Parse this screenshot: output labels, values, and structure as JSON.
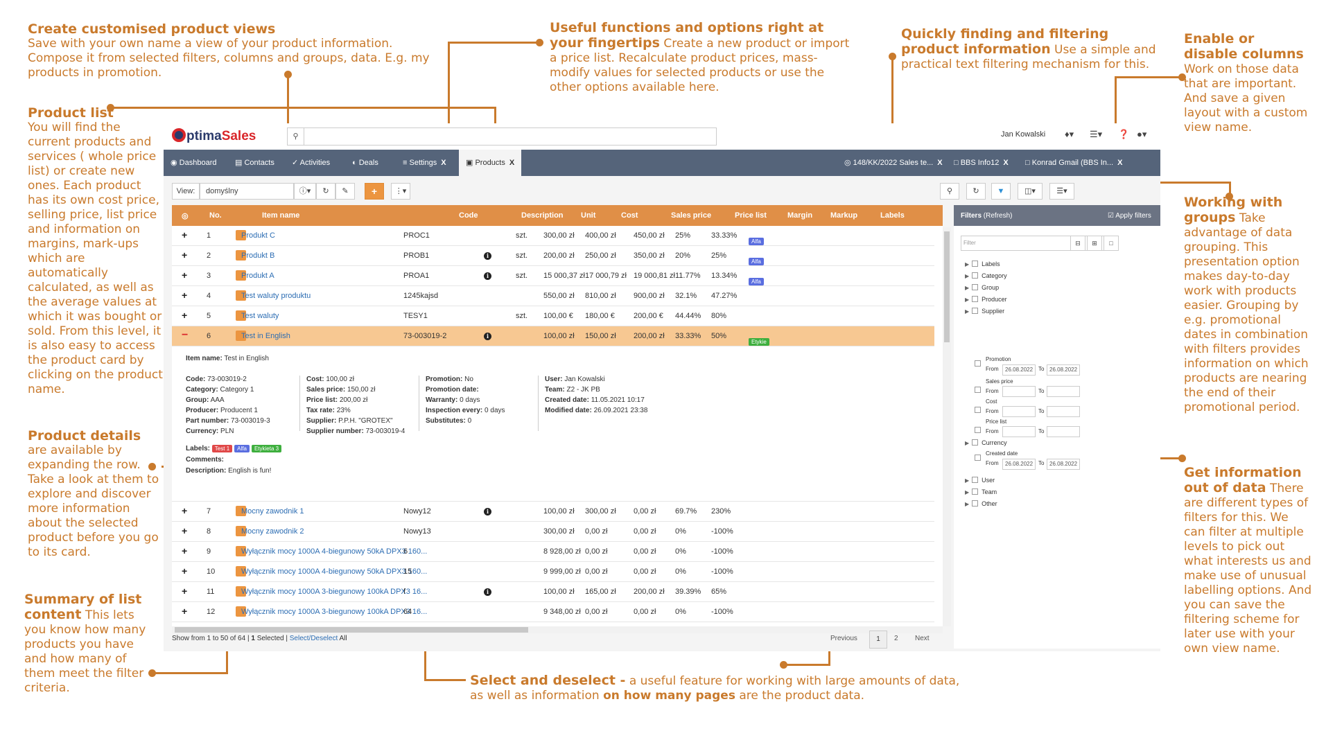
{
  "annotations": {
    "views": {
      "title": "Create customised product views",
      "body": "Save with your own name a view of your product information. Compose it from selected filters, columns and groups, data. E.g. my products in promotion."
    },
    "list": {
      "title": "Product list",
      "body": "You will find the current products and services ( whole price list) or create new ones. Each product has its own cost price, selling price, list price and information on margins, mark-ups which are automatically calculated, as well as the average values at which it was bought or sold. From this level, it is also easy to access the product card by clicking on the product name."
    },
    "details": {
      "title": "Product details",
      "body": "are available by expanding the row. Take a look at them to explore and discover more information about the selected product before you go to its card."
    },
    "summary": {
      "title": "Summary of list content",
      "body": "This lets you know how many products you have and how many of them meet the filter criteria."
    },
    "functions": {
      "title": "Useful functions and options right at your fingertips",
      "body": "Create a new product or import a price list. Recalculate product prices, mass-modify values for selected products or use the other options available here."
    },
    "finding": {
      "title": "Quickly finding and filtering product information",
      "body": "Use a simple and practical text filtering mechanism for this."
    },
    "columns": {
      "title": "Enable or disable columns",
      "body": "Work on those data that are important. And save a given layout with a custom view name."
    },
    "groups": {
      "title": "Working with groups",
      "body": "Take advantage of data grouping. This presentation option makes day-to-day work with products easier. Grouping by e.g. promotional dates in combination with filters provides information on which products are nearing the end of their promotional period."
    },
    "info": {
      "title": "Get information out of data",
      "body": "There are different types of filters for this. We can filter at multiple levels to pick out what interests us and make use of unusual labelling options. And you can save the filtering scheme for later use with your own view name."
    },
    "select": {
      "title": "Select and deselect -",
      "body": "a useful feature for working with large amounts of data, as well as information",
      "bold2": "on how many pages",
      "tail": "are the product data."
    }
  },
  "app": {
    "logo_o": "O",
    "logo_ptima": "ptima",
    "logo_sales": "Sales",
    "user": "Jan Kowalski",
    "nav": [
      {
        "label": "Dashboard",
        "icon": "dashboard-icon"
      },
      {
        "label": "Contacts",
        "icon": "contacts-icon"
      },
      {
        "label": "Activities",
        "icon": "activities-icon"
      },
      {
        "label": "Deals",
        "icon": "deals-icon"
      },
      {
        "label": "Settings",
        "icon": "settings-icon"
      },
      {
        "label": "Products",
        "icon": "box-icon"
      }
    ],
    "open_tabs": [
      "148/KK/2022 Sales te...",
      "BBS Info12",
      "Konrad Gmail (BBS In..."
    ],
    "close_mark": "X",
    "view_label": "View:",
    "view_value": "domyślny",
    "add_symbol": "+",
    "columns": [
      "No.",
      "Item name",
      "Code",
      "Description",
      "Unit",
      "Cost",
      "Sales price",
      "Price list",
      "Margin",
      "Markup",
      "Labels"
    ],
    "rows": [
      {
        "no": "1",
        "name": "Produkt C",
        "code": "PROC1",
        "desc": "",
        "unit": "szt.",
        "cost": "300,00 zł",
        "sales": "400,00 zł",
        "list": "450,00 zł",
        "margin": "25%",
        "markup": "33.33%",
        "labels": [
          "Alfa"
        ]
      },
      {
        "no": "2",
        "name": "Produkt B",
        "code": "PROB1",
        "desc": "i",
        "unit": "szt.",
        "cost": "200,00 zł",
        "sales": "250,00 zł",
        "list": "350,00 zł",
        "margin": "20%",
        "markup": "25%",
        "labels": [
          "Alfa"
        ]
      },
      {
        "no": "3",
        "name": "Produkt A",
        "code": "PROA1",
        "desc": "i",
        "unit": "szt.",
        "cost": "15 000,37 zł",
        "sales": "17 000,79 zł",
        "list": "19 000,81 zł",
        "margin": "11.77%",
        "markup": "13.34%",
        "labels": [
          "Alfa"
        ]
      },
      {
        "no": "4",
        "name": "Test waluty produktu",
        "code": "1245kajsd",
        "desc": "",
        "unit": "",
        "cost": "550,00 zł",
        "sales": "810,00 zł",
        "list": "900,00 zł",
        "margin": "32.1%",
        "markup": "47.27%",
        "labels": []
      },
      {
        "no": "5",
        "name": "Test waluty",
        "code": "TESY1",
        "desc": "",
        "unit": "szt.",
        "cost": "100,00 €",
        "sales": "180,00 €",
        "list": "200,00 €",
        "margin": "44.44%",
        "markup": "80%",
        "labels": []
      },
      {
        "no": "6",
        "name": "Test in English",
        "code": "73-003019-2",
        "desc": "i",
        "unit": "",
        "cost": "100,00 zł",
        "sales": "150,00 zł",
        "list": "200,00 zł",
        "margin": "33.33%",
        "markup": "50%",
        "labels": [
          "Test 1",
          "Alfa",
          "Etykie"
        ]
      }
    ],
    "rows2": [
      {
        "no": "7",
        "name": "Mocny zawodnik 1",
        "code": "Nowy12",
        "desc": "i",
        "cost": "100,00 zł",
        "sales": "300,00 zł",
        "list": "0,00 zł",
        "margin": "69.7%",
        "markup": "230%"
      },
      {
        "no": "8",
        "name": "Mocny zawodnik 2",
        "code": "Nowy13",
        "desc": "",
        "cost": "300,00 zł",
        "sales": "0,00 zł",
        "list": "0,00 zł",
        "margin": "0%",
        "markup": "-100%"
      },
      {
        "no": "9",
        "name": "Wyłącznik mocy 1000A 4-biegunowy 50kA DPX3 160...",
        "code": "6",
        "desc": "",
        "cost": "8 928,00 zł",
        "sales": "0,00 zł",
        "list": "0,00 zł",
        "margin": "0%",
        "markup": "-100%"
      },
      {
        "no": "10",
        "name": "Wyłącznik mocy 1000A 4-biegunowy 50kA DPX3 160...",
        "code": "15",
        "desc": "",
        "cost": "9 999,00 zł",
        "sales": "0,00 zł",
        "list": "0,00 zł",
        "margin": "0%",
        "markup": "-100%"
      },
      {
        "no": "11",
        "name": "Wyłącznik mocy 1000A 3-biegunowy 100kA DPX3 16...",
        "code": "f",
        "desc": "i",
        "cost": "100,00 zł",
        "sales": "165,00 zł",
        "list": "200,00 zł",
        "margin": "39.39%",
        "markup": "65%"
      },
      {
        "no": "12",
        "name": "Wyłącznik mocy 1000A 3-biegunowy 100kA DPX3 16...",
        "code": "64",
        "desc": "",
        "cost": "9 348,00 zł",
        "sales": "0,00 zł",
        "list": "0,00 zł",
        "margin": "0%",
        "markup": "-100%"
      }
    ],
    "details": {
      "item_name_label": "Item name:",
      "item_name": "Test in English",
      "col1": [
        [
          "Code:",
          "73-003019-2"
        ],
        [
          "Category:",
          "Category 1"
        ],
        [
          "Group:",
          "AAA"
        ],
        [
          "Producer:",
          "Producent 1"
        ],
        [
          "Part number:",
          "73-003019-3"
        ],
        [
          "Currency:",
          "PLN"
        ]
      ],
      "col2": [
        [
          "Cost:",
          "100,00 zł"
        ],
        [
          "Sales price:",
          "150,00 zł"
        ],
        [
          "Price list:",
          "200,00 zł"
        ],
        [
          "Tax rate:",
          "23%"
        ],
        [
          "Supplier:",
          "P.P.H. \"GROTEX\""
        ],
        [
          "Supplier number:",
          "73-003019-4"
        ]
      ],
      "col3": [
        [
          "Promotion:",
          "No"
        ],
        [
          "Promotion date:",
          ""
        ],
        [
          "Warranty:",
          "0 days"
        ],
        [
          "Inspection every:",
          "0 days"
        ],
        [
          "Substitutes:",
          "0"
        ]
      ],
      "col4": [
        [
          "User:",
          "Jan Kowalski"
        ],
        [
          "Team:",
          "Z2 - JK PB"
        ],
        [
          "Created date:",
          "11.05.2021 10:17"
        ],
        [
          "Modified date:",
          "26.09.2021 23:38"
        ]
      ],
      "labels_label": "Labels:",
      "labels": [
        "Test 1",
        "Alfa",
        "Etykieta 3"
      ],
      "comments_label": "Comments:",
      "description_label": "Description:",
      "description": "English is fun!"
    },
    "footer": {
      "show": "Show from 1 to 50 of 64 |",
      "selected_count": "1",
      "selected": "Selected |",
      "select_link": "Select/Deselect",
      "all": "All",
      "previous": "Previous",
      "page1": "1",
      "page2": "2",
      "next": "Next"
    },
    "filters": {
      "title": "Filters",
      "refresh": "(Refresh)",
      "apply": "Apply filters",
      "placeholder": "Filter",
      "groups_top": [
        "Labels",
        "Category",
        "Group",
        "Producer",
        "Supplier"
      ],
      "promotion": "Promotion",
      "from": "From",
      "to": "To",
      "date_from": "26.08.2022",
      "date_to": "26.08.2022",
      "sales_price": "Sales price",
      "cost": "Cost",
      "price_list": "Price list",
      "currency": "Currency",
      "created_date": "Created date",
      "groups_bottom": [
        "User",
        "Team",
        "Other"
      ]
    }
  }
}
